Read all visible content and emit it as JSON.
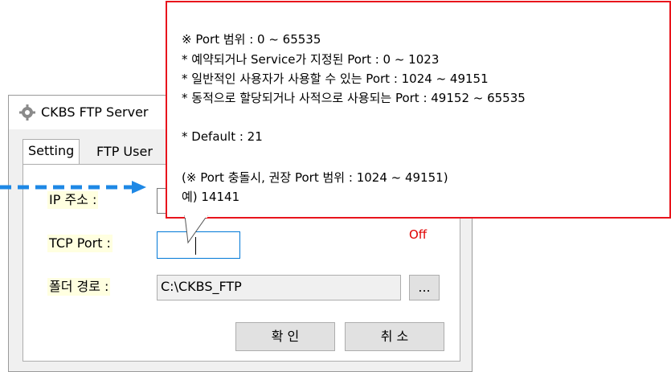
{
  "window": {
    "title": "CKBS FTP Server"
  },
  "tabs": [
    {
      "label": "Setting"
    },
    {
      "label": "FTP User"
    }
  ],
  "form": {
    "ip_label": "IP 주소 :",
    "ip_value": "",
    "port_label": "TCP Port :",
    "port_value": "",
    "folder_label": "폴더 경로 :",
    "folder_value": "C:\\CKBS_FTP",
    "browse_label": "...",
    "status": "Off"
  },
  "buttons": {
    "ok": "확 인",
    "cancel": "취 소"
  },
  "tooltip": {
    "lines": [
      "※ Port 범위 : 0 ~ 65535",
      "* 예약되거나 Service가 지정된 Port : 0 ~ 1023",
      "* 일반적인 사용자가 사용할 수 있는 Port : 1024 ~ 49151",
      "* 동적으로 할당되거나 사적으로 사용되는 Port : 49152 ~ 65535",
      "* Default : 21",
      "(※ Port 충돌시, 권장 Port 범위 : 1024 ~ 49151)",
      "예) 14141"
    ]
  },
  "colors": {
    "tooltip_border": "#e8141c",
    "arrow": "#1e88e5",
    "status": "#e00000",
    "label_highlight": "#ffffe0"
  }
}
